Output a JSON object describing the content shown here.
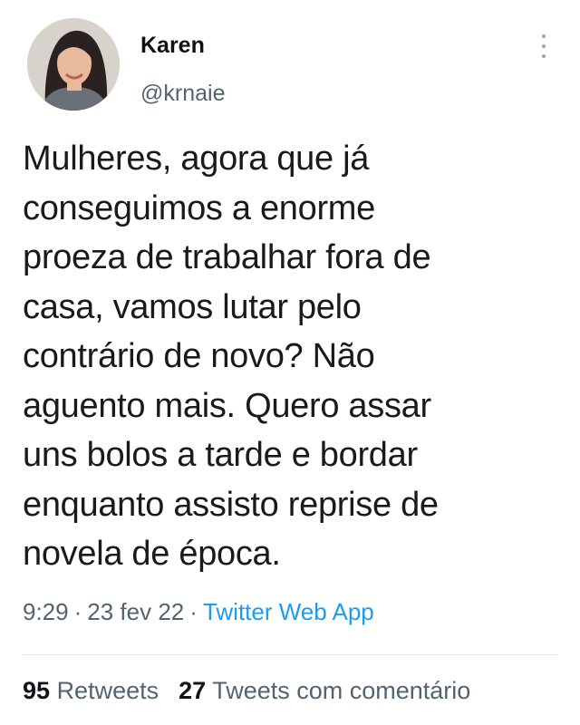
{
  "author": {
    "display_name": "Karen",
    "handle": "@krnaie"
  },
  "tweet": {
    "lines": [
      "Mulheres, agora que já",
      "conseguimos a enorme",
      "proeza de trabalhar fora de",
      "casa, vamos lutar pelo",
      "contrário de novo? Não",
      "aguento mais. Quero assar",
      "uns bolos a tarde e bordar",
      "enquanto assisto reprise de",
      "novela de época."
    ],
    "time": "9:29",
    "date": "23 fev 22",
    "separator": "·",
    "source": "Twitter Web App"
  },
  "stats": {
    "retweets_count": "95",
    "retweets_label": "Retweets",
    "quotes_count": "27",
    "quotes_label": "Tweets com comentário"
  },
  "icons": {
    "avatar": "profile-photo",
    "more": "more-vertical-icon"
  },
  "colors": {
    "link": "#1d9bf0",
    "secondary_text": "#536471"
  }
}
